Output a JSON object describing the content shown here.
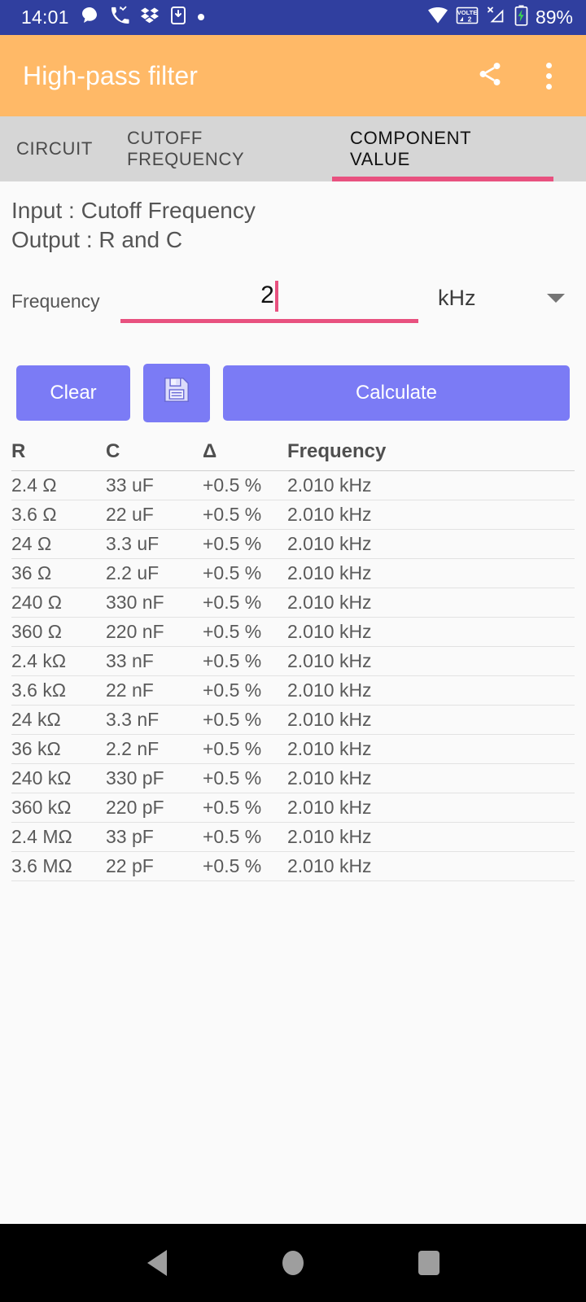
{
  "status_bar": {
    "time": "14:01",
    "battery_text": "89%",
    "icons_left": [
      "chat-bubble-icon",
      "missed-call-icon",
      "dropbox-icon",
      "phone-download-icon",
      "dot-icon"
    ],
    "icons_right": [
      "wifi-icon",
      "volte-2-icon",
      "no-signal-icon",
      "battery-charging-icon"
    ],
    "background_color": "#303F9F"
  },
  "app_bar": {
    "title": "High-pass filter",
    "share_icon": "share-icon",
    "overflow_icon": "more-vertical-icon",
    "background_color": "#FFB967"
  },
  "tabs": {
    "items": [
      {
        "label": "CIRCUIT",
        "active": false
      },
      {
        "label": "CUTOFF FREQUENCY",
        "active": false
      },
      {
        "label": "COMPONENT VALUE",
        "active": true
      }
    ],
    "indicator_color": "#E8517F"
  },
  "io_info": {
    "input_line": "Input : Cutoff Frequency",
    "output_line": "Output : R and C"
  },
  "frequency_field": {
    "label": "Frequency",
    "value": "2",
    "placeholder": "",
    "unit": "kHz",
    "unit_dropdown_icon": "chevron-down-icon",
    "accent_color": "#E8517F"
  },
  "buttons": {
    "clear_label": "Clear",
    "save_icon": "save-floppy-icon",
    "calculate_label": "Calculate",
    "color": "#7B7BF5"
  },
  "results_table": {
    "columns": [
      "R",
      "C",
      "Δ",
      "Frequency"
    ],
    "rows": [
      {
        "r": "2.4 Ω",
        "c": "33 uF",
        "delta": "+0.5 %",
        "frequency": "2.010 kHz"
      },
      {
        "r": "3.6 Ω",
        "c": "22 uF",
        "delta": "+0.5 %",
        "frequency": "2.010 kHz"
      },
      {
        "r": "24 Ω",
        "c": "3.3 uF",
        "delta": "+0.5 %",
        "frequency": "2.010 kHz"
      },
      {
        "r": "36 Ω",
        "c": "2.2 uF",
        "delta": "+0.5 %",
        "frequency": "2.010 kHz"
      },
      {
        "r": "240 Ω",
        "c": "330 nF",
        "delta": "+0.5 %",
        "frequency": "2.010 kHz"
      },
      {
        "r": "360 Ω",
        "c": "220 nF",
        "delta": "+0.5 %",
        "frequency": "2.010 kHz"
      },
      {
        "r": "2.4 kΩ",
        "c": "33 nF",
        "delta": "+0.5 %",
        "frequency": "2.010 kHz"
      },
      {
        "r": "3.6 kΩ",
        "c": "22 nF",
        "delta": "+0.5 %",
        "frequency": "2.010 kHz"
      },
      {
        "r": "24 kΩ",
        "c": "3.3 nF",
        "delta": "+0.5 %",
        "frequency": "2.010 kHz"
      },
      {
        "r": "36 kΩ",
        "c": "2.2 nF",
        "delta": "+0.5 %",
        "frequency": "2.010 kHz"
      },
      {
        "r": "240 kΩ",
        "c": "330 pF",
        "delta": "+0.5 %",
        "frequency": "2.010 kHz"
      },
      {
        "r": "360 kΩ",
        "c": "220 pF",
        "delta": "+0.5 %",
        "frequency": "2.010 kHz"
      },
      {
        "r": "2.4 MΩ",
        "c": "33 pF",
        "delta": "+0.5 %",
        "frequency": "2.010 kHz"
      },
      {
        "r": "3.6 MΩ",
        "c": "22 pF",
        "delta": "+0.5 %",
        "frequency": "2.010 kHz"
      }
    ]
  },
  "nav_bar": {
    "back_icon": "back-triangle-icon",
    "home_icon": "home-circle-icon",
    "recents_icon": "recents-square-icon"
  }
}
